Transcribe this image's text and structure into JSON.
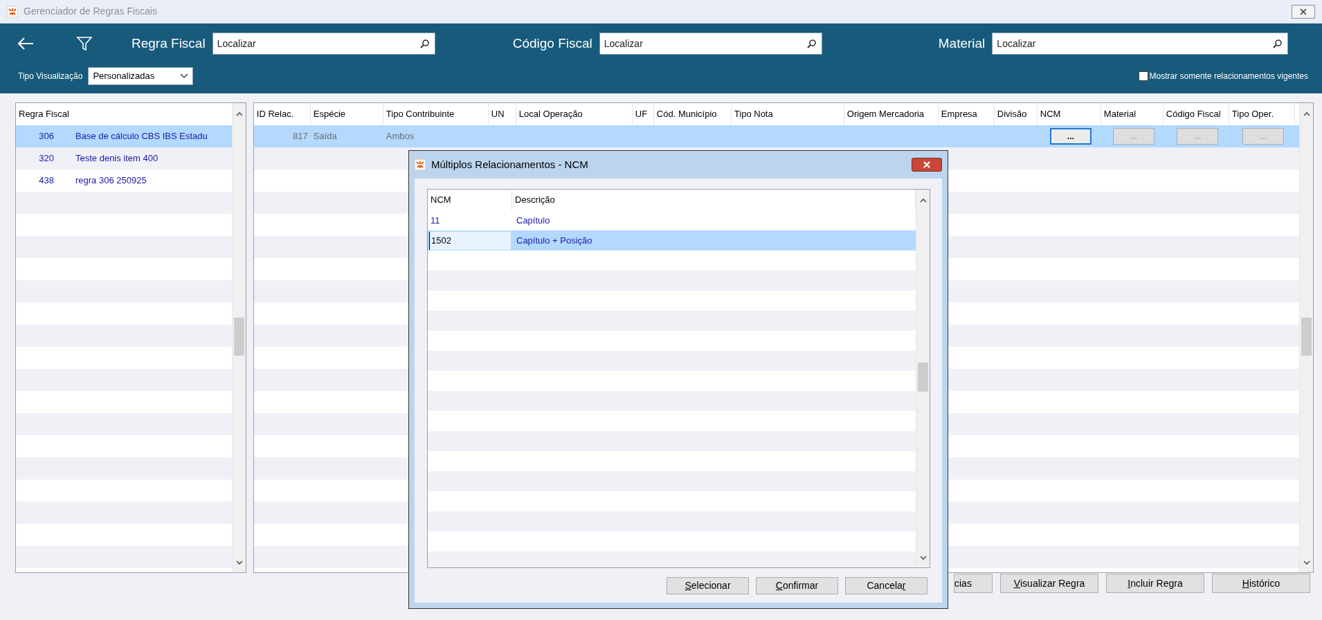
{
  "window": {
    "title": "Gerenciador de Regras Fiscais"
  },
  "toolbar": {
    "search_fields": [
      {
        "label": "Regra Fiscal",
        "placeholder": "Localizar"
      },
      {
        "label": "Código Fiscal",
        "placeholder": "Localizar"
      },
      {
        "label": "Material",
        "placeholder": "Localizar"
      }
    ],
    "view_type": {
      "label": "Tipo Visualização",
      "value": "Personalizadas"
    },
    "current_only": {
      "label": "Mostrar somente relacionamentos vigentes",
      "checked": false
    }
  },
  "rules_list": {
    "column": "Regra Fiscal",
    "rows": [
      {
        "code": "306",
        "name": "Base de cálculo CBS IBS Estadu",
        "selected": true
      },
      {
        "code": "320",
        "name": "Teste denis item 400",
        "selected": false
      },
      {
        "code": "438",
        "name": "regra 306 250925",
        "selected": false
      }
    ]
  },
  "relations_table": {
    "columns": [
      "ID Relac.",
      "Espécie",
      "Tipo Contribuinte",
      "UN",
      "Local Operação",
      "UF",
      "Cód. Município",
      "Tipo Nota",
      "Origem Mercadoria",
      "Empresa",
      "Divisão",
      "NCM",
      "Material",
      "Código Fiscal",
      "Tipo Oper."
    ],
    "rows": [
      {
        "selected": true,
        "cells": [
          {
            "kind": "number",
            "text": "817"
          },
          {
            "kind": "text",
            "text": "Saída"
          },
          {
            "kind": "text",
            "text": "Ambos"
          },
          {
            "kind": "blank"
          },
          {
            "kind": "blank"
          },
          {
            "kind": "blank"
          },
          {
            "kind": "blank"
          },
          {
            "kind": "blank"
          },
          {
            "kind": "blank"
          },
          {
            "kind": "blank"
          },
          {
            "kind": "blank"
          },
          {
            "kind": "button",
            "text": "...",
            "focused": true
          },
          {
            "kind": "button",
            "text": "...",
            "focused": false
          },
          {
            "kind": "button",
            "text": "...",
            "focused": false
          },
          {
            "kind": "button",
            "text": "...",
            "focused": false
          }
        ]
      }
    ]
  },
  "dialog": {
    "title": "Múltiplos Relacionamentos - NCM",
    "columns": [
      "NCM",
      "Descrição"
    ],
    "rows": [
      {
        "ncm": "11",
        "description": "Capítulo",
        "selected": false,
        "editing": false
      },
      {
        "ncm": "1502",
        "description": "Capítulo + Posição",
        "selected": true,
        "editing": true
      }
    ],
    "buttons": [
      {
        "label": "Selecionar",
        "shortcut_on_last_letter": false
      },
      {
        "label": "Confirmar",
        "shortcut_on_last_letter": false
      },
      {
        "label": "Cancelar",
        "shortcut_on_last_letter": true
      }
    ]
  },
  "buttons": [
    {
      "label": "cias"
    },
    {
      "label": "Visualizar Regra",
      "shortcut_on_last_letter": false
    },
    {
      "label": "Incluir Regra",
      "shortcut_on_last_letter": false
    },
    {
      "label": "Histórico",
      "shortcut_on_last_letter": false
    }
  ]
}
